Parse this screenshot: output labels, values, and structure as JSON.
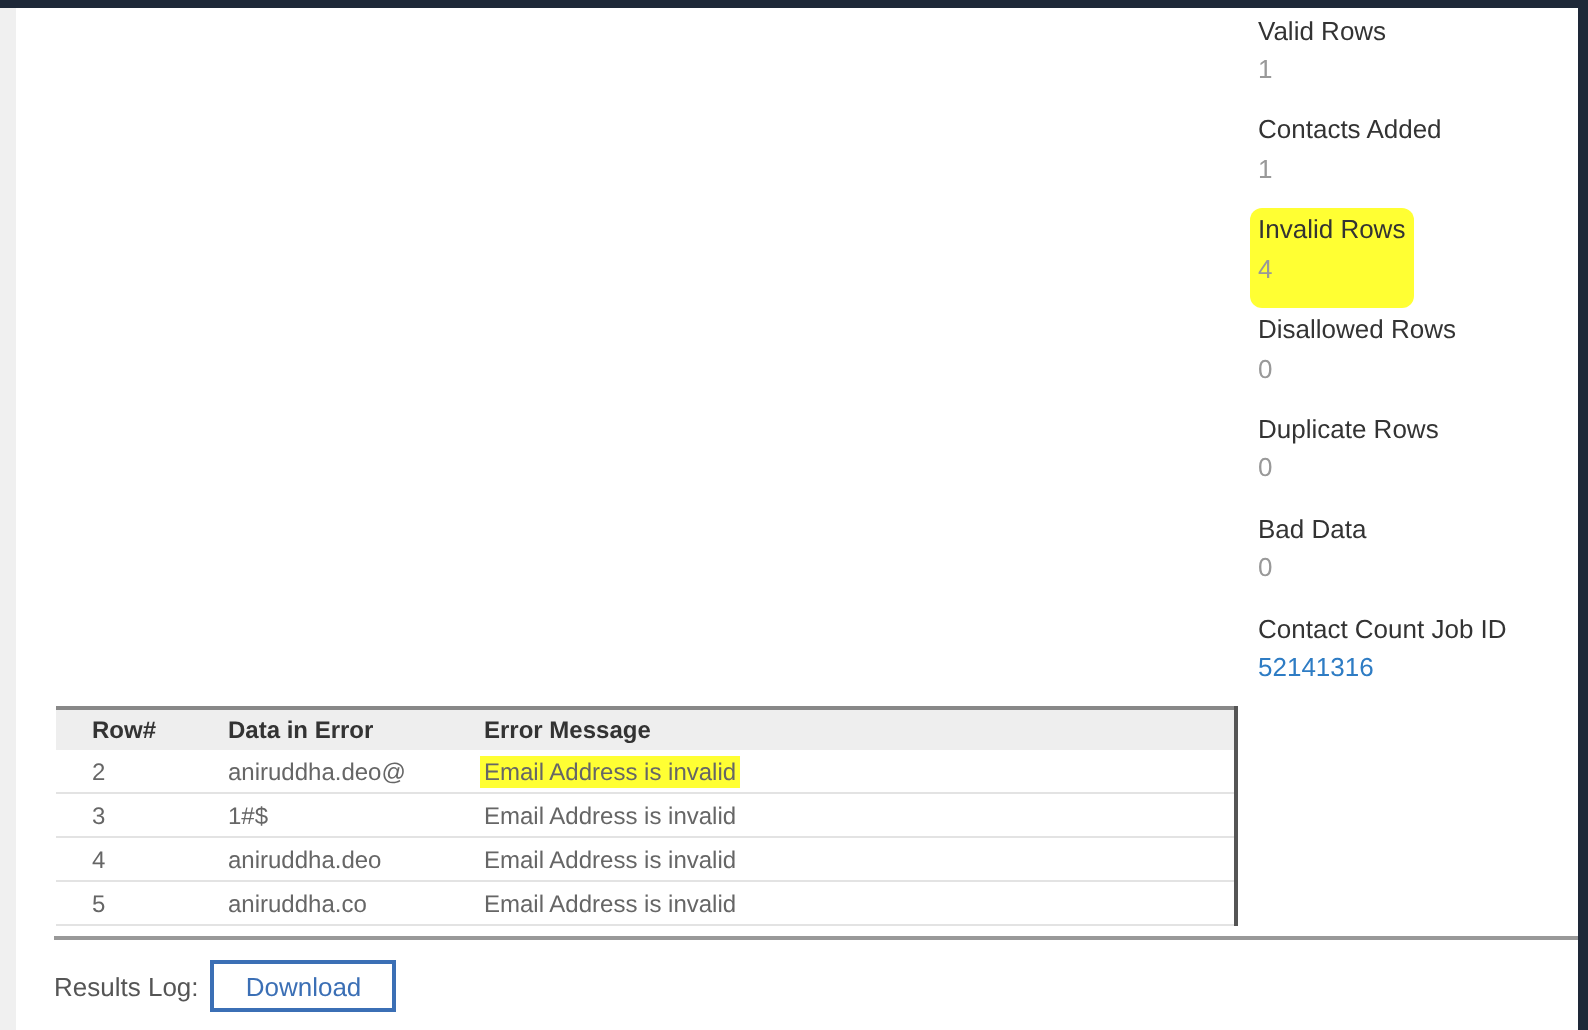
{
  "stats": [
    {
      "label": "Valid Rows",
      "value": "1",
      "kind": "number",
      "highlighted": false
    },
    {
      "label": "Contacts Added",
      "value": "1",
      "kind": "number",
      "highlighted": false
    },
    {
      "label": "Invalid Rows",
      "value": "4",
      "kind": "number",
      "highlighted": true
    },
    {
      "label": "Disallowed Rows",
      "value": "0",
      "kind": "number",
      "highlighted": false
    },
    {
      "label": "Duplicate Rows",
      "value": "0",
      "kind": "number",
      "highlighted": false
    },
    {
      "label": "Bad Data",
      "value": "0",
      "kind": "number",
      "highlighted": false
    },
    {
      "label": "Contact Count Job ID",
      "value": "52141316",
      "kind": "link",
      "highlighted": false
    }
  ],
  "error_table": {
    "columns": [
      "Row#",
      "Data in Error",
      "Error Message"
    ],
    "rows": [
      {
        "cells": [
          "2",
          "aniruddha.deo@",
          "Email Address is invalid"
        ],
        "highlighted": true
      },
      {
        "cells": [
          "3",
          "1#$",
          "Email Address is invalid"
        ],
        "highlighted": false
      },
      {
        "cells": [
          "4",
          "aniruddha.deo",
          "Email Address is invalid"
        ],
        "highlighted": false
      },
      {
        "cells": [
          "5",
          "aniruddha.co",
          "Email Address is invalid"
        ],
        "highlighted": false
      }
    ]
  },
  "results_log": {
    "label": "Results Log:",
    "button": "Download"
  }
}
